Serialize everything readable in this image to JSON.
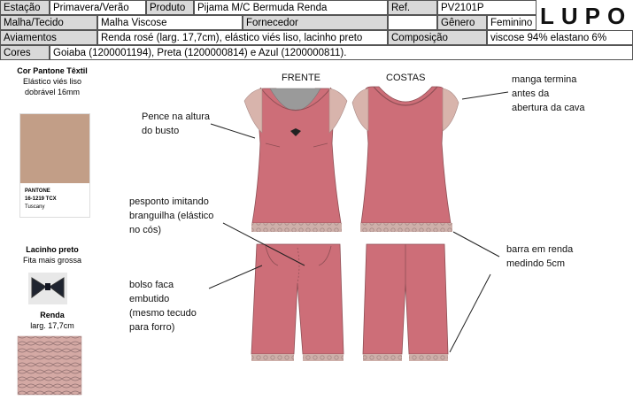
{
  "header": {
    "row1": {
      "estacao_label": "Estação",
      "estacao_value": "Primavera/Verão",
      "produto_label": "Produto",
      "produto_value": "Pijama M/C Bermuda Renda",
      "ref_label": "Ref.",
      "ref_value": "PV2101P"
    },
    "row2": {
      "malha_label": "Malha/Tecido",
      "malha_value": "Malha Viscose",
      "fornecedor_label": "Fornecedor",
      "fornecedor_value": "",
      "genero_label": "Gênero",
      "genero_value": "Feminino"
    },
    "row3": {
      "aviamentos_label": "Aviamentos",
      "aviamentos_value": "Renda rosé (larg. 17,7cm), elástico viés liso, lacinho preto",
      "composicao_label": "Composição",
      "composicao_value": "viscose 94% elastano 6%"
    },
    "row4": {
      "cores_label": "Cores",
      "cores_value": "Goiaba (1200001194), Preta (1200000814) e Azul (1200000811)."
    },
    "logo_text": "LUPO"
  },
  "sidebar": {
    "pantone_title": "Cor Pantone Têxtil",
    "pantone_desc1": "Elástico viés liso",
    "pantone_desc2": "dobrável 16mm",
    "swatch_name": "PANTONE",
    "swatch_code": "16-1219 TCX",
    "swatch_label": "Tuscany",
    "swatch_color": "#c29e87",
    "lacinho_title": "Lacinho preto",
    "lacinho_desc": "Fita mais grossa",
    "renda_title": "Renda",
    "renda_desc": "larg. 17,7cm"
  },
  "views": {
    "front": "FRENTE",
    "back": "COSTAS"
  },
  "annotations": {
    "pence": "Pence na altura\ndo busto",
    "pesponto": "pesponto imitando\nbranguilha (elástico\nno cós)",
    "bolso": "bolso faca\nembutido\n(mesmo tecudo\npara forro)",
    "manga": "manga termina\nantes da\nabertura da cava",
    "barra": "barra em renda\nmedindo 5cm"
  },
  "colors": {
    "garment": "#cd6e78",
    "garment_dark": "#b85f69",
    "lace": "#d8b4ac",
    "inner": "#9a9a9a",
    "header_label_bg": "#d9d9d9"
  }
}
